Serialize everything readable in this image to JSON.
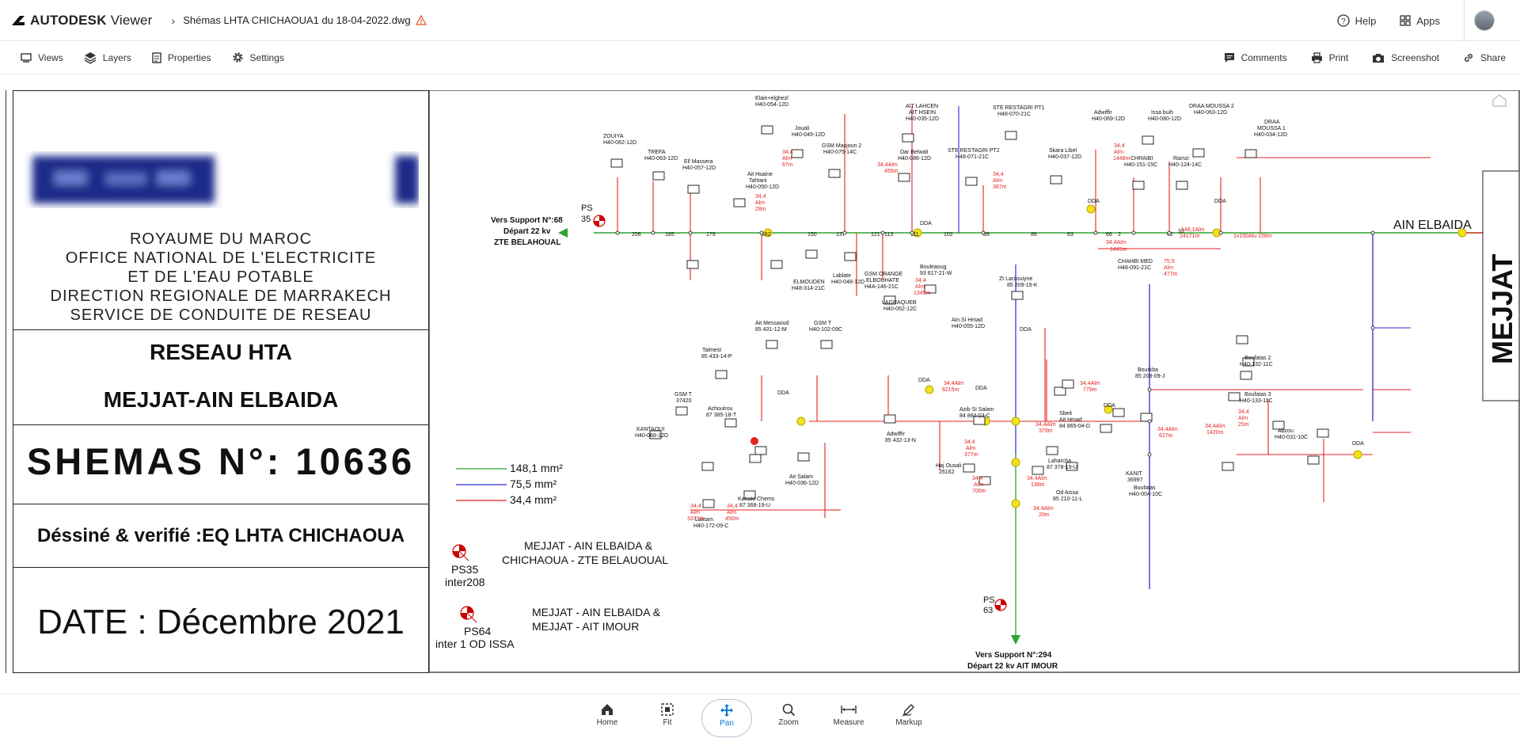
{
  "header": {
    "brand": "AUTODESK",
    "product": "Viewer",
    "file_name": "Shémas LHTA CHICHAOUA1 du 18-04-2022.dwg",
    "help_label": "Help",
    "apps_label": "Apps"
  },
  "toolbar": {
    "views": "Views",
    "layers": "Layers",
    "properties": "Properties",
    "settings": "Settings",
    "comments": "Comments",
    "print": "Print",
    "screenshot": "Screenshot",
    "share": "Share"
  },
  "title_block": {
    "org_lines": [
      "ROYAUME DU MAROC",
      "OFFICE NATIONAL DE L'ELECTRICITE",
      "ET DE L'EAU POTABLE",
      "DIRECTION REGIONALE DE MARRAKECH",
      "SERVICE DE CONDUITE DE RESEAU"
    ],
    "network": "RESEAU HTA",
    "section": "MEJJAT-AIN ELBAIDA",
    "schema": "SHEMAS N°: 10636",
    "drawn_by": "Déssiné & verifié :EQ LHTA CHICHAOUA",
    "date": "DATE : Décembre 2021"
  },
  "diagram": {
    "side_title": "MEJJAT",
    "legend": [
      "148,1 mm²",
      "75,5  mm²",
      "34,4  mm²"
    ],
    "legend_colors": [
      "#2ea42e",
      "#2b2bd6",
      "#e52222"
    ],
    "ps35_label": "PS35\ninter208",
    "ps35_caption_1": "MEJJAT - AIN ELBAIDA &",
    "ps35_caption_2": "CHICHAOUA - ZTE BELAUOUAL",
    "ps64_label": "PS64",
    "ps64_sub": "inter 1 OD ISSA",
    "ps64_caption_1": "MEJJAT - AIN ELBAIDA &",
    "ps64_caption_2": "MEJJAT - AIT IMOUR",
    "left_support_1": "Vers Support N°:68",
    "left_support_2": "Départ 22 kv",
    "left_support_3": "ZTE BELAHOUAL",
    "right_name": "AIN ELBAIDA",
    "bottom_support_1": "Vers Support N°:294",
    "bottom_support_2": "Départ 22 kv AIT IMOUR",
    "ps35_map": "PS",
    "ps35_num": "35",
    "ps63_map": "PS",
    "ps63_num": "63"
  },
  "bottom_tools": {
    "home": "Home",
    "fit": "Fit",
    "pan": "Pan",
    "zoom": "Zoom",
    "measure": "Measure",
    "markup": "Markup"
  }
}
